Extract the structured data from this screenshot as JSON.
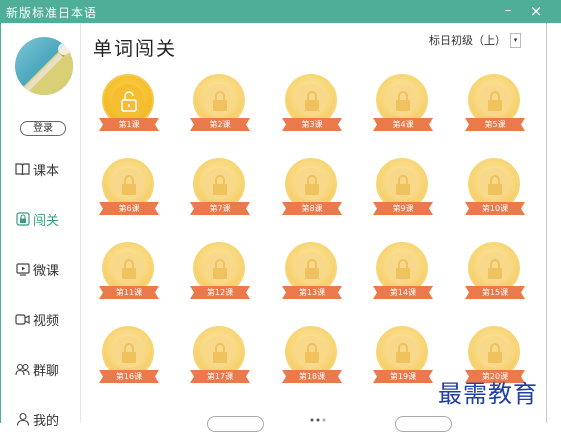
{
  "window": {
    "title": "新版标准日本语",
    "minimize_glyph": "–",
    "close_glyph": "×"
  },
  "colors": {
    "accent": "#4fae97",
    "ribbon": "#ea7a4b",
    "coin": "#f8d67a",
    "coin_active": "#f4bd2a"
  },
  "sidebar": {
    "login_label": "登录",
    "items": [
      {
        "label": "课本",
        "icon": "book-icon"
      },
      {
        "label": "闯关",
        "icon": "lock-icon",
        "active": true
      },
      {
        "label": "微课",
        "icon": "play-screen-icon"
      },
      {
        "label": "视频",
        "icon": "video-camera-icon"
      },
      {
        "label": "群聊",
        "icon": "group-chat-icon"
      },
      {
        "label": "我的",
        "icon": "user-icon"
      }
    ]
  },
  "main": {
    "title": "单词闯关",
    "level": "标日初级（上）",
    "level_dropdown_glyph": "▾",
    "lessons": [
      "第1课",
      "第2课",
      "第3课",
      "第4课",
      "第5课",
      "第6课",
      "第7课",
      "第8课",
      "第9课",
      "第10课",
      "第11课",
      "第12课",
      "第13课",
      "第14课",
      "第15课",
      "第16课",
      "第17课",
      "第18课",
      "第19课",
      "第20课"
    ]
  },
  "watermark": "最需教育"
}
